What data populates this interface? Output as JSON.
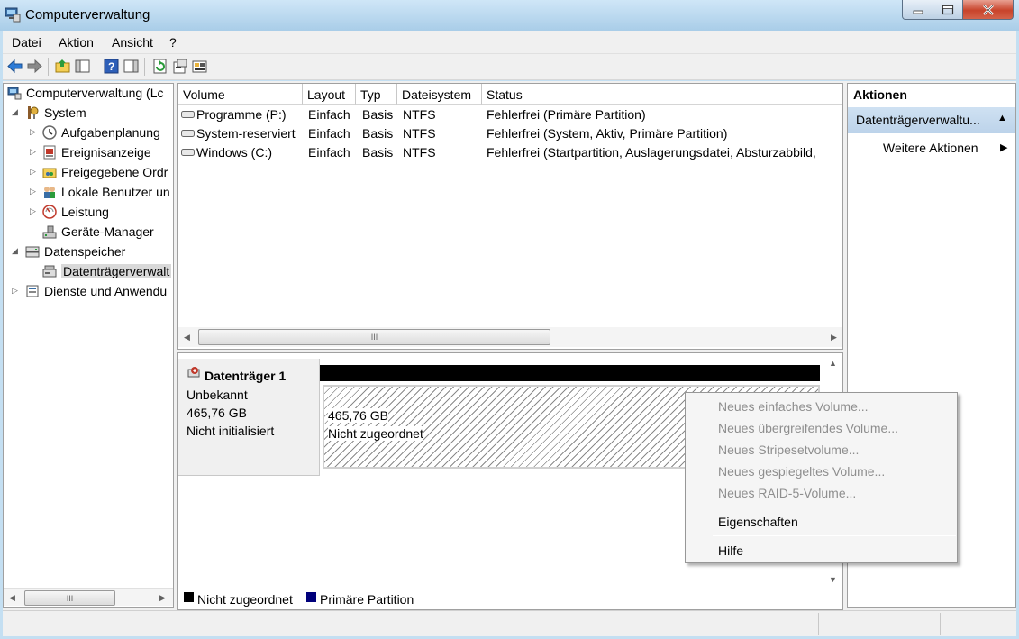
{
  "window": {
    "title": "Computerverwaltung",
    "buttons": [
      "minimize-icon",
      "maximize-icon",
      "close-icon"
    ]
  },
  "menu": {
    "items": [
      "Datei",
      "Aktion",
      "Ansicht",
      "?"
    ]
  },
  "tree": {
    "root": "Computerverwaltung (Lc",
    "system": "System",
    "items": [
      {
        "label": "Aufgabenplanung",
        "icon": "clock-icon"
      },
      {
        "label": "Ereignisanzeige",
        "icon": "event-viewer-icon"
      },
      {
        "label": "Freigegebene Ordr",
        "icon": "shared-folder-icon"
      },
      {
        "label": "Lokale Benutzer un",
        "icon": "users-icon"
      },
      {
        "label": "Leistung",
        "icon": "performance-icon"
      },
      {
        "label": "Geräte-Manager",
        "icon": "device-manager-icon"
      }
    ],
    "storage": "Datenspeicher",
    "disk_mgmt": "Datenträgerverwalt",
    "services": "Dienste und Anwendu"
  },
  "volumes": {
    "columns": [
      "Volume",
      "Layout",
      "Typ",
      "Dateisystem",
      "Status"
    ],
    "rows": [
      [
        "Programme (P:)",
        "Einfach",
        "Basis",
        "NTFS",
        "Fehlerfrei (Primäre Partition)"
      ],
      [
        "System-reserviert",
        "Einfach",
        "Basis",
        "NTFS",
        "Fehlerfrei (System, Aktiv, Primäre Partition)"
      ],
      [
        "Windows (C:)",
        "Einfach",
        "Basis",
        "NTFS",
        "Fehlerfrei (Startpartition, Auslagerungsdatei, Absturzabbild,"
      ]
    ]
  },
  "disk": {
    "name": "Datenträger 1",
    "type": "Unbekannt",
    "size": "465,76 GB",
    "state": "Nicht initialisiert",
    "partition_size": "465,76 GB",
    "partition_state": "Nicht zugeordnet"
  },
  "legend": {
    "unallocated": "Nicht zugeordnet",
    "primary": "Primäre Partition",
    "unallocated_color": "#000000",
    "primary_color": "#00007b"
  },
  "actions": {
    "header": "Aktionen",
    "section": "Datenträgerverwaltu...",
    "more": "Weitere Aktionen"
  },
  "context_menu": {
    "disabled_items": [
      "Neues einfaches Volume...",
      "Neues übergreifendes Volume...",
      "Neues Stripesetvolume...",
      "Neues gespiegeltes Volume...",
      "Neues RAID-5-Volume..."
    ],
    "properties": "Eigenschaften",
    "help": "Hilfe"
  }
}
